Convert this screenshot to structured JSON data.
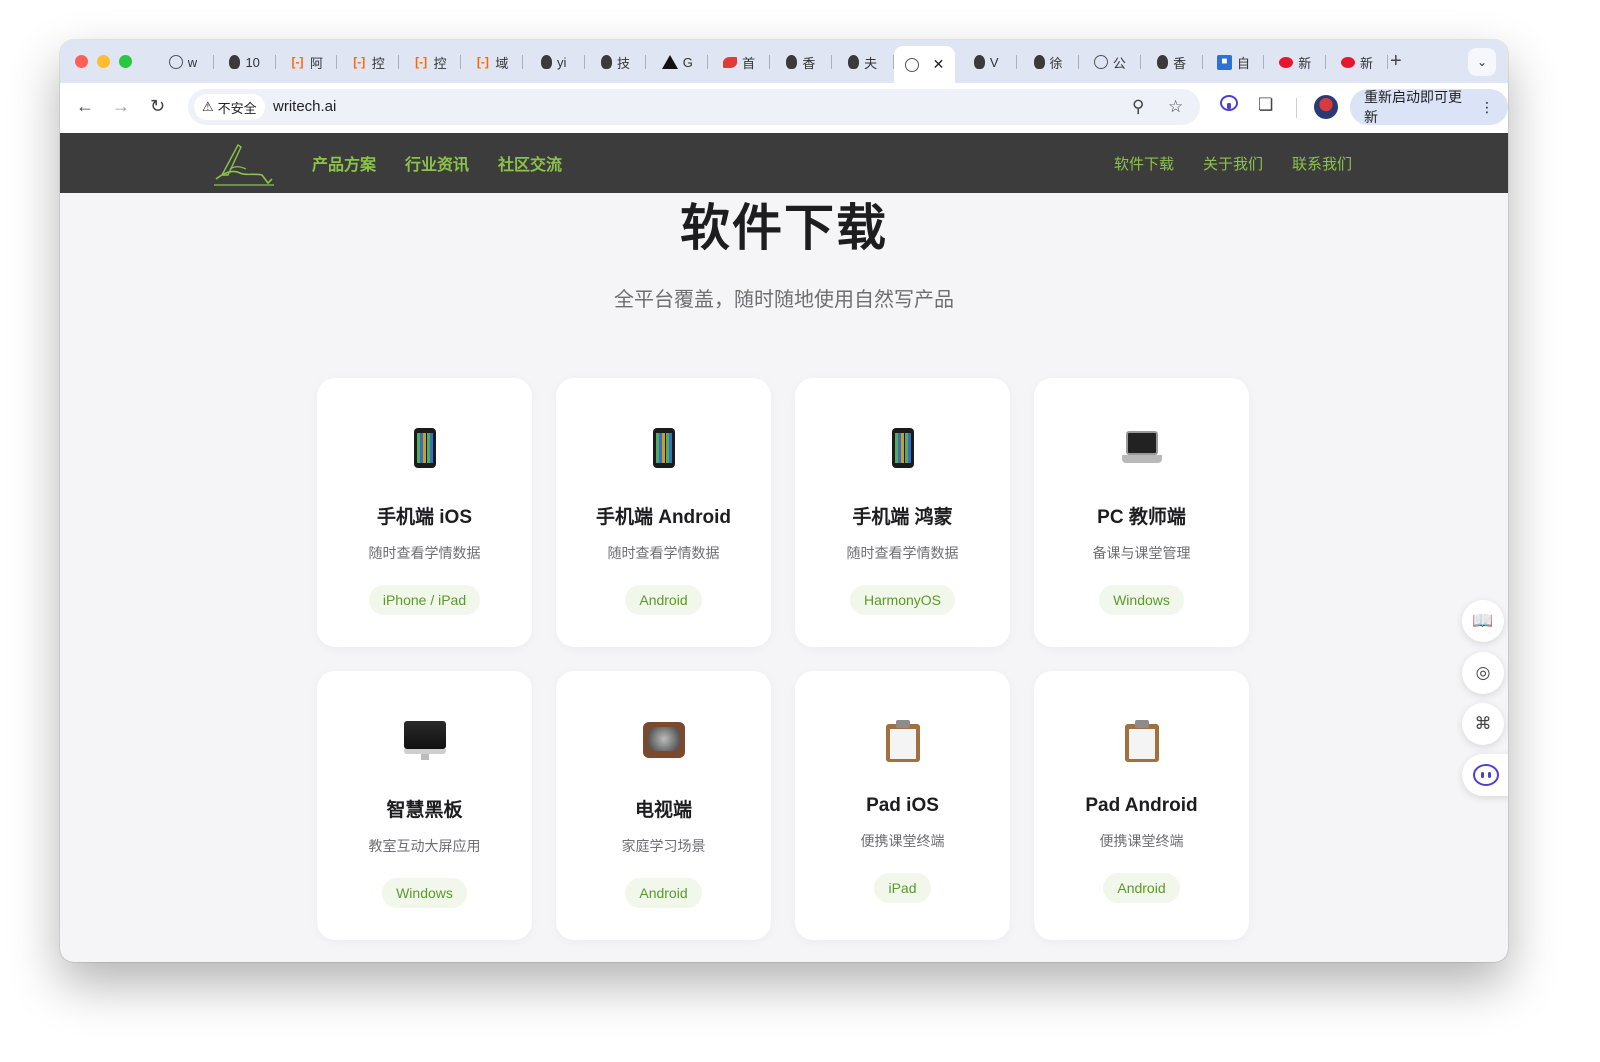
{
  "browser": {
    "tabs": [
      {
        "icon": "globe-icon",
        "label": "w"
      },
      {
        "icon": "person-icon",
        "label": "10"
      },
      {
        "icon": "bracket-icon",
        "label": "阿"
      },
      {
        "icon": "bracket-icon",
        "label": "控"
      },
      {
        "icon": "bracket-icon",
        "label": "控"
      },
      {
        "icon": "bracket-icon",
        "label": "域"
      },
      {
        "icon": "person-icon",
        "label": "yi"
      },
      {
        "icon": "person-icon",
        "label": "技"
      },
      {
        "icon": "triangle-icon",
        "label": "G"
      },
      {
        "icon": "red-logo-icon",
        "label": "首"
      },
      {
        "icon": "person-icon",
        "label": "香"
      },
      {
        "icon": "person-icon",
        "label": "夫"
      },
      {
        "icon": "globe-icon",
        "label": "",
        "active": true
      },
      {
        "icon": "person-icon",
        "label": "V"
      },
      {
        "icon": "person-icon",
        "label": "徐"
      },
      {
        "icon": "globe-icon",
        "label": "公"
      },
      {
        "icon": "person-icon",
        "label": "香"
      },
      {
        "icon": "blue-logo-icon",
        "label": "自"
      },
      {
        "icon": "weibo-icon",
        "label": "新"
      },
      {
        "icon": "weibo-icon",
        "label": "新"
      }
    ],
    "security_label": "不安全",
    "url": "writech.ai",
    "update_button": "重新启动即可更新"
  },
  "nav": {
    "left": [
      "产品方案",
      "行业资讯",
      "社区交流"
    ],
    "right": [
      "软件下载",
      "关于我们",
      "联系我们"
    ]
  },
  "page": {
    "title": "软件下载",
    "subtitle": "全平台覆盖，随时随地使用自然写产品"
  },
  "cards": [
    {
      "icon": "phone-icon",
      "title": "手机端 iOS",
      "desc": "随时查看学情数据",
      "badge": "iPhone / iPad"
    },
    {
      "icon": "phone-icon",
      "title": "手机端 Android",
      "desc": "随时查看学情数据",
      "badge": "Android"
    },
    {
      "icon": "phone-icon",
      "title": "手机端 鸿蒙",
      "desc": "随时查看学情数据",
      "badge": "HarmonyOS"
    },
    {
      "icon": "laptop-icon",
      "title": "PC 教师端",
      "desc": "备课与课堂管理",
      "badge": "Windows"
    },
    {
      "icon": "monitor-icon",
      "title": "智慧黑板",
      "desc": "教室互动大屏应用",
      "badge": "Windows"
    },
    {
      "icon": "tv-icon",
      "title": "电视端",
      "desc": "家庭学习场景",
      "badge": "Android"
    },
    {
      "icon": "clipboard-icon",
      "title": "Pad iOS",
      "desc": "便携课堂终端",
      "badge": "iPad"
    },
    {
      "icon": "clipboard-icon",
      "title": "Pad Android",
      "desc": "便携课堂终端",
      "badge": "Android"
    }
  ],
  "colors": {
    "nav_bg": "#3c3c3c",
    "accent_green": "#8bc34a",
    "badge_bg": "#f1f7ea",
    "badge_text": "#5a9a2a"
  }
}
